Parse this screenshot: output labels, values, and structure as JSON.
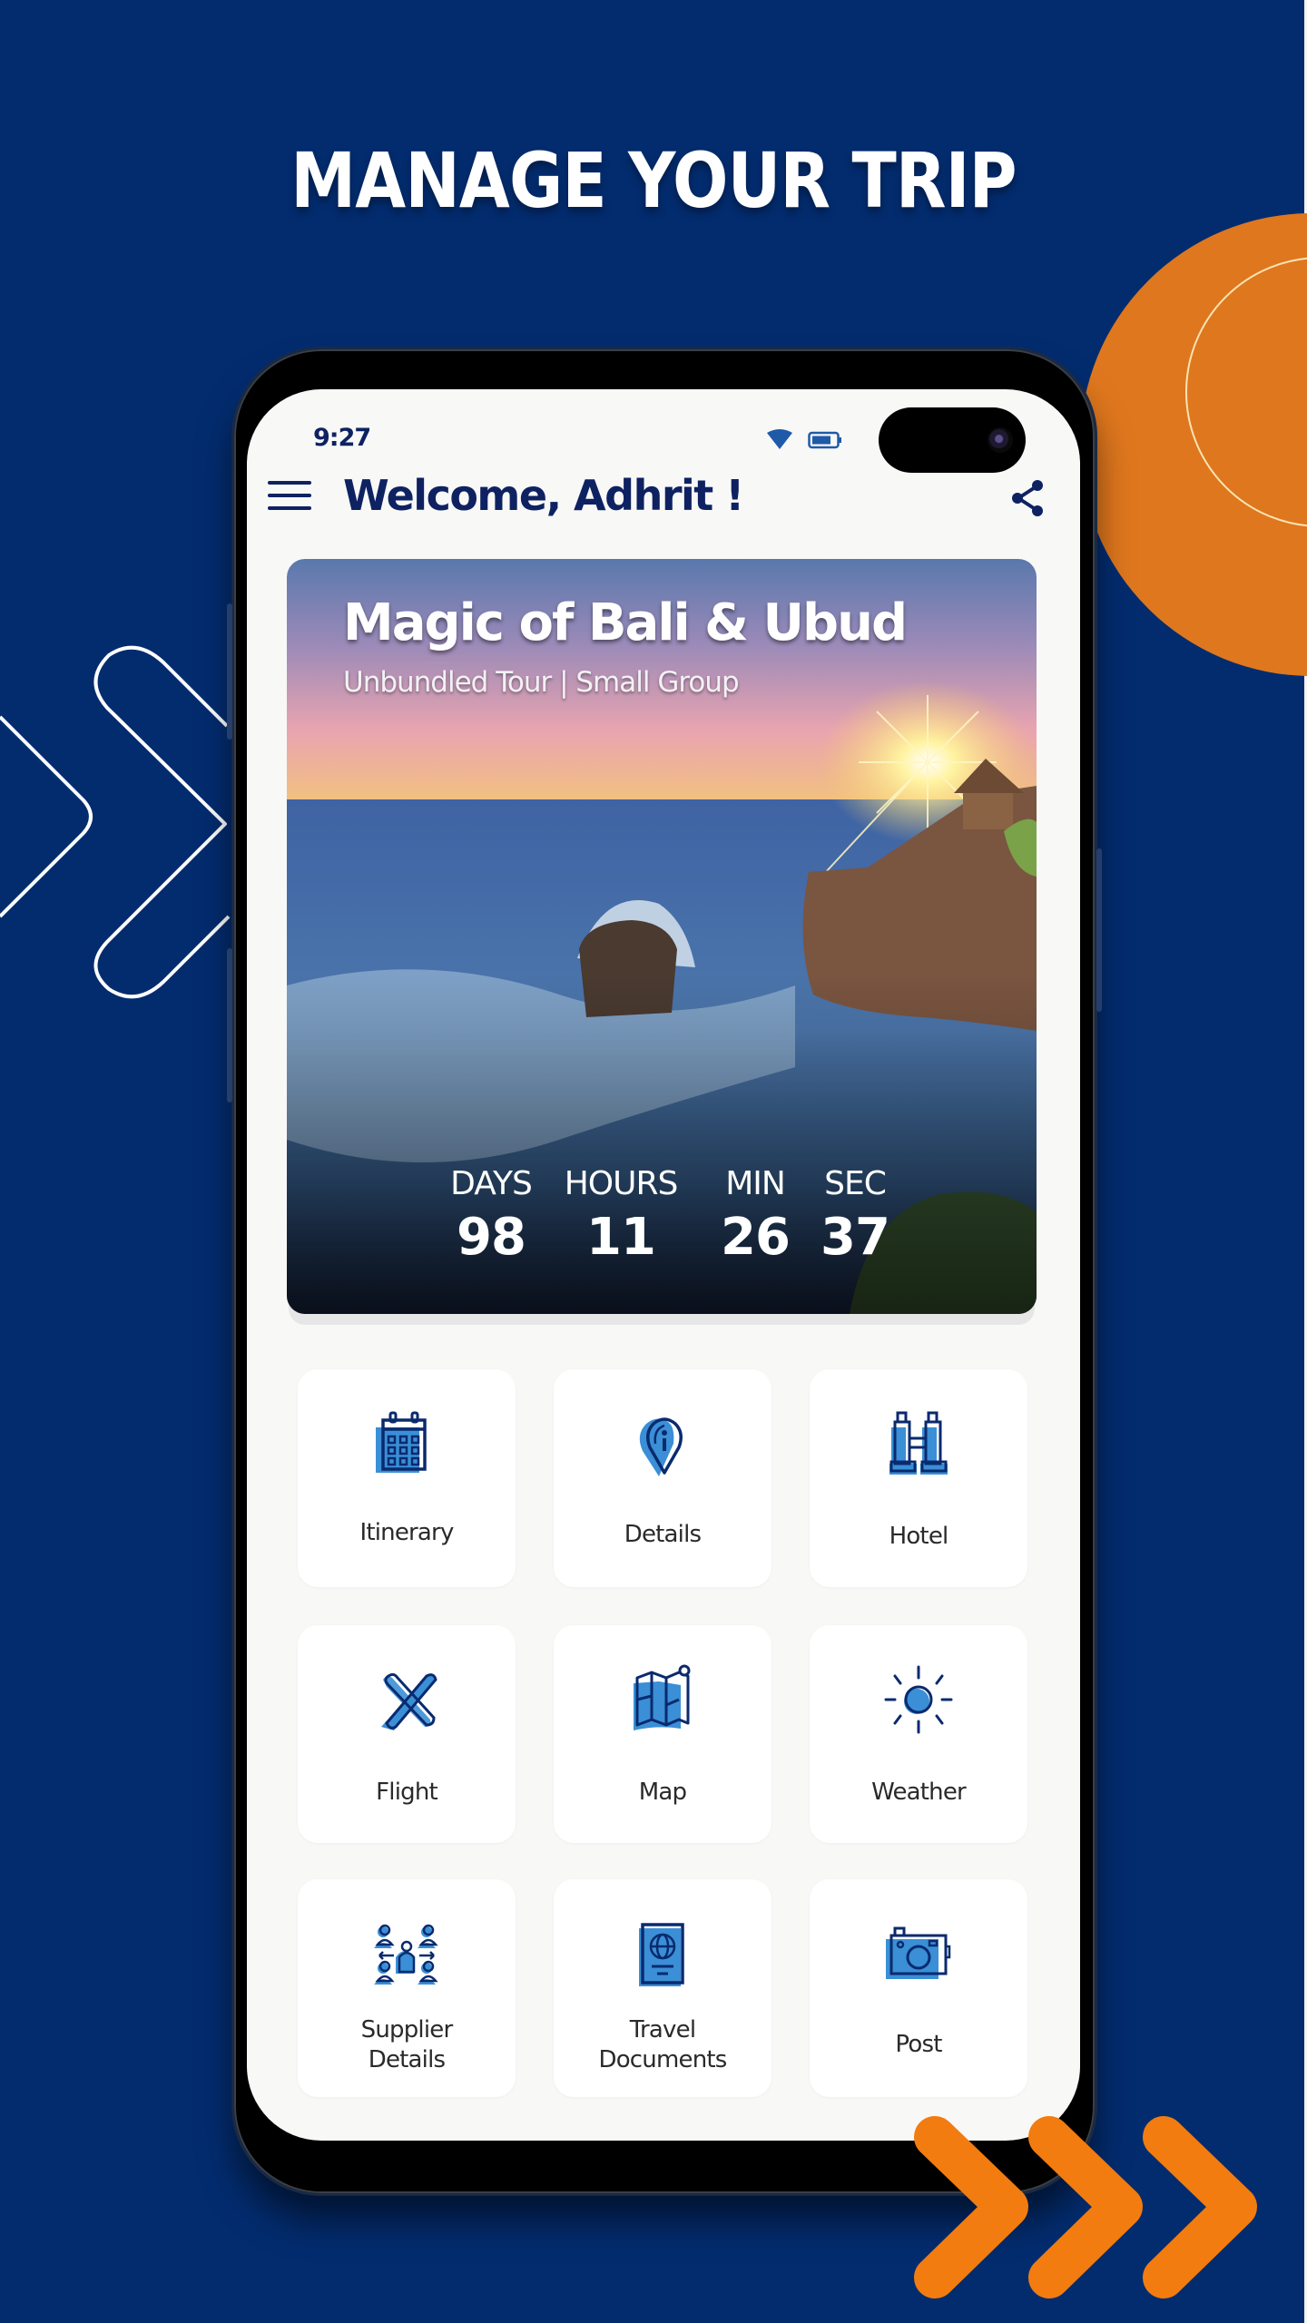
{
  "headline": "MANAGE YOUR TRIP",
  "colors": {
    "background": "#032c6f",
    "accent_orange": "#f27c0f",
    "circle_orange": "#df771e",
    "navy_text": "#0e2262",
    "icon_blue": "#3a8fd6",
    "icon_stroke": "#0a2a6e"
  },
  "status_bar": {
    "time": "9:27",
    "icons": [
      "wifi-icon",
      "battery-icon"
    ]
  },
  "app_bar": {
    "menu_icon": "hamburger-menu-icon",
    "title": "Welcome, Adhrit !",
    "share_icon": "share-icon"
  },
  "trip_banner": {
    "title": "Magic of Bali & Ubud",
    "subtitle": "Unbundled Tour | Small Group",
    "image": "bali-temple-sunset-photo",
    "countdown": [
      {
        "label": "DAYS",
        "value": "98"
      },
      {
        "label": "HOURS",
        "value": "11"
      },
      {
        "label": "MIN",
        "value": "26"
      },
      {
        "label": "SEC",
        "value": "37"
      }
    ]
  },
  "menu_tiles": [
    {
      "label": "Itinerary",
      "icon": "calendar-icon"
    },
    {
      "label": "Details",
      "icon": "info-pin-icon"
    },
    {
      "label": "Hotel",
      "icon": "hotel-building-icon"
    },
    {
      "label": "Flight",
      "icon": "airplane-icon"
    },
    {
      "label": "Map",
      "icon": "map-icon"
    },
    {
      "label": "Weather",
      "icon": "sun-icon"
    },
    {
      "label": "Supplier\nDetails",
      "label_line1": "Supplier",
      "label_line2": "Details",
      "icon": "supplier-network-icon"
    },
    {
      "label": "Travel\nDocuments",
      "label_line1": "Travel",
      "label_line2": "Documents",
      "icon": "passport-icon"
    },
    {
      "label": "Post",
      "icon": "camera-icon"
    }
  ]
}
